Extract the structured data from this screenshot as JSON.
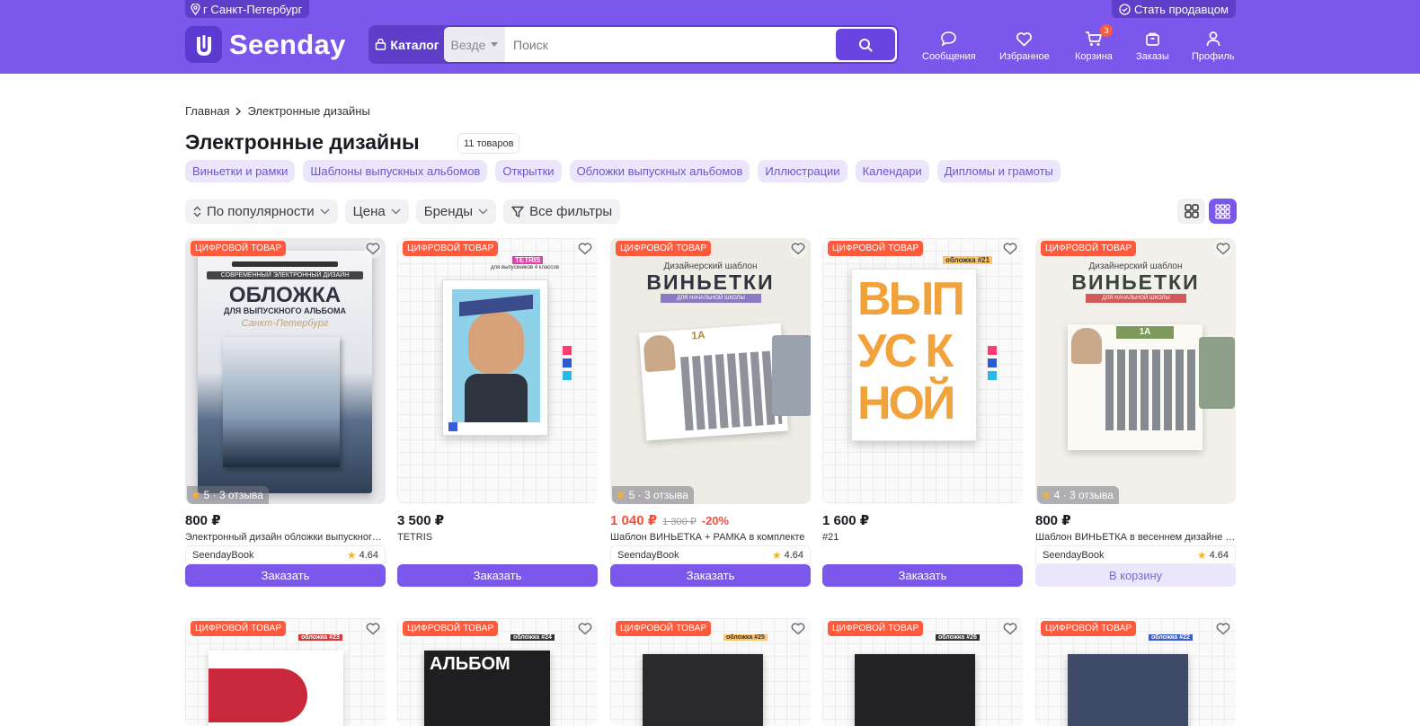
{
  "header": {
    "city": "г Санкт-Петербург",
    "become_seller": "Стать продавцом",
    "logo": "Seenday",
    "catalog": "Каталог",
    "scope": "Везде",
    "search_placeholder": "Поиск",
    "nav": [
      {
        "label": "Сообщения",
        "icon": "chat-icon"
      },
      {
        "label": "Избранное",
        "icon": "heart-icon"
      },
      {
        "label": "Корзина",
        "icon": "cart-icon",
        "badge": "3"
      },
      {
        "label": "Заказы",
        "icon": "box-icon"
      },
      {
        "label": "Профиль",
        "icon": "user-icon"
      }
    ]
  },
  "breadcrumb": {
    "home": "Главная",
    "current": "Электронные дизайны"
  },
  "page": {
    "title": "Электронные дизайны",
    "count": "11 товаров"
  },
  "categories": [
    "Виньетки и рамки",
    "Шаблоны выпускных альбомов",
    "Открытки",
    "Обложки выпускных альбомов",
    "Иллюстрации",
    "Календари",
    "Дипломы и грамоты"
  ],
  "filters": {
    "sort": "По популярности",
    "price": "Цена",
    "brands": "Бренды",
    "all": "Все фильтры"
  },
  "colors": {
    "accent": "#7b57eb",
    "tag": "#ff5a3c",
    "chip_bg": "#ebe6fb"
  },
  "products": [
    {
      "tag": "ЦИФРОВОЙ ТОВАР",
      "rating": "5 · 3 отзыва",
      "price": "800 ₽",
      "name": "Электронный дизайн обложки выпускного альбома",
      "seller": "SeendayBook",
      "seller_rating": "4.64",
      "button": "Заказать"
    },
    {
      "tag": "ЦИФРОВОЙ ТОВАР",
      "price": "3 500 ₽",
      "name": "TETRIS",
      "button": "Заказать"
    },
    {
      "tag": "ЦИФРОВОЙ ТОВАР",
      "rating": "5 · 3 отзыва",
      "price": "1 040 ₽",
      "old_price": "1 300 ₽",
      "discount": "-20%",
      "name": "Шаблон ВИНЬЕТКА + РАМКА в комплекте",
      "seller": "SeendayBook",
      "seller_rating": "4.64",
      "button": "Заказать"
    },
    {
      "tag": "ЦИФРОВОЙ ТОВАР",
      "price": "1 600 ₽",
      "name": "#21",
      "button": "Заказать"
    },
    {
      "tag": "ЦИФРОВОЙ ТОВАР",
      "rating": "4 · 3 отзыва",
      "price": "800 ₽",
      "name": "Шаблон ВИНЬЕТКА в весеннем дизайне для начальной школы",
      "seller": "SeendayBook",
      "seller_rating": "4.64",
      "button": "В корзину"
    }
  ],
  "products_row2": [
    {
      "tag": "ЦИФРОВОЙ ТОВАР"
    },
    {
      "tag": "ЦИФРОВОЙ ТОВАР"
    },
    {
      "tag": "ЦИФРОВОЙ ТОВАР"
    },
    {
      "tag": "ЦИФРОВОЙ ТОВАР"
    },
    {
      "tag": "ЦИФРОВОЙ ТОВАР"
    }
  ],
  "product_art": {
    "p1": {
      "kicker": "СОВРЕМЕННЫЙ ЭЛЕКТРОННЫЙ ДИЗАЙН",
      "title": "ОБЛОЖКА",
      "subtitle": "ДЛЯ ВЫПУСКНОГО АЛЬБОМА",
      "city": "Санкт-Петербург"
    },
    "p2": {
      "label": "TETRIS",
      "side": "для выпускников 4 классов"
    },
    "p3": {
      "kicker": "Дизайнерский шаблон",
      "title": "ВИНЬЕТКИ",
      "band": "ДЛЯ НАЧАЛЬНОЙ ШКОЛЫ",
      "grade": "1А"
    },
    "p4": {
      "label": "обложка #21",
      "lines": [
        "ВЫП",
        "УС К",
        "НОЙ"
      ]
    },
    "p5": {
      "kicker": "Дизайнерский шаблон",
      "title": "ВИНЬЕТКИ",
      "band": "ДЛЯ НАЧАЛЬНОЙ ШКОЛЫ",
      "grade": "1А"
    },
    "r2": [
      {
        "label": "обложка #23"
      },
      {
        "label": "обложка #24",
        "text": "АЛЬБОМ"
      },
      {
        "label": "обложка #25"
      },
      {
        "label": "обложка #26"
      },
      {
        "label": "обложка #22"
      }
    ]
  }
}
